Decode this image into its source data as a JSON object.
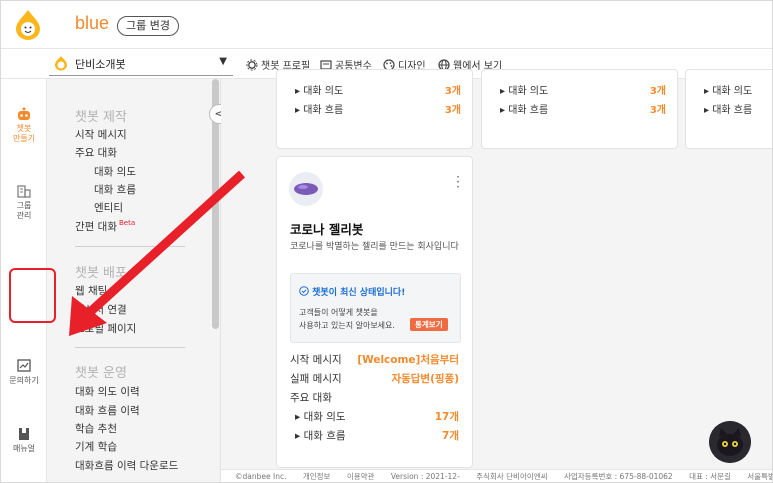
{
  "header": {
    "app_name": "blue",
    "group_change_label": "그룹 변경"
  },
  "subbar": {
    "selected_bot": "단비소개봇",
    "nav": [
      {
        "label": "챗봇 프로필",
        "icon": "gear-icon"
      },
      {
        "label": "공통변수",
        "icon": "variable-icon"
      },
      {
        "label": "디자인",
        "icon": "palette-icon"
      },
      {
        "label": "웹에서 보기",
        "icon": "globe-icon"
      }
    ]
  },
  "rail": {
    "items": [
      {
        "label_line1": "챗봇",
        "label_line2": "만들기",
        "icon": "robot-icon"
      },
      {
        "label_line1": "그룹",
        "label_line2": "관리",
        "icon": "building-icon"
      },
      {
        "label_line1": "문의하기",
        "label_line2": "",
        "icon": "inquiry-icon"
      },
      {
        "label_line1": "매뉴얼",
        "label_line2": "",
        "icon": "manual-icon"
      }
    ]
  },
  "menu": {
    "section_build": "챗봇 제작",
    "start_message": "시작 메시지",
    "main_dialog": "주요 대화",
    "dialog_intent": "대화 의도",
    "dialog_flow": "대화 흐름",
    "entity": "엔티티",
    "simple_dialog": "간편 대화",
    "beta": "Beta",
    "section_deploy": "챗봇 배포",
    "deploy_web_partial": "웹 채팅",
    "deploy_msg_partial": "메신저 연결",
    "deploy_page_partial": "프로필 페이지",
    "section_ops": "챗봇 운영",
    "intent_history": "대화 의도 이력",
    "flow_history": "대화 흐름 이력",
    "learn_recommend": "학습 추천",
    "machine_learning": "기계 학습",
    "history_download": "대화흐름 이력 다운로드"
  },
  "top_cards": [
    {
      "intent_label": "대화 의도",
      "intent_count": "3개",
      "flow_label": "대화 흐름",
      "flow_count": "3개"
    },
    {
      "intent_label": "대화 의도",
      "intent_count": "3개",
      "flow_label": "대화 흐름",
      "flow_count": "3개"
    },
    {
      "intent_label": "대화 의도",
      "flow_label": "대화 흐름"
    }
  ],
  "bot_card": {
    "title": "코로나 젤리봇",
    "description": "코로나를 박멸하는 젤리를 만드는 회사입니다",
    "status": "챗봇이 최신 상태입니다!",
    "status_line1": "고객들이 어떻게 챗봇을",
    "status_line2": "사용하고 있는지 알아보세요.",
    "stats_button": "통계보기",
    "start_message_label": "시작 메시지",
    "start_message_value": "[Welcome]처음부터",
    "fail_message_label": "실패 메시지",
    "fail_message_value": "자동답변(핑퐁)",
    "main_dialog_label": "주요 대화",
    "intent_label": "대화 의도",
    "intent_count": "17개",
    "flow_label": "대화 흐름",
    "flow_count": "7개"
  },
  "footer": {
    "items": [
      "©danbee Inc.",
      "개인정보",
      "이용약관",
      "Version : 2021-12-",
      "주식회사 단비아이엔씨",
      "사업자등록번호 : 675-88-01062",
      "대표 : 서문길",
      "서울특별시"
    ]
  },
  "colors": {
    "accent": "#f28a2e",
    "annotation_red": "#e8202a",
    "status_blue": "#1d6fd1",
    "stats_button": "#f06b42"
  }
}
